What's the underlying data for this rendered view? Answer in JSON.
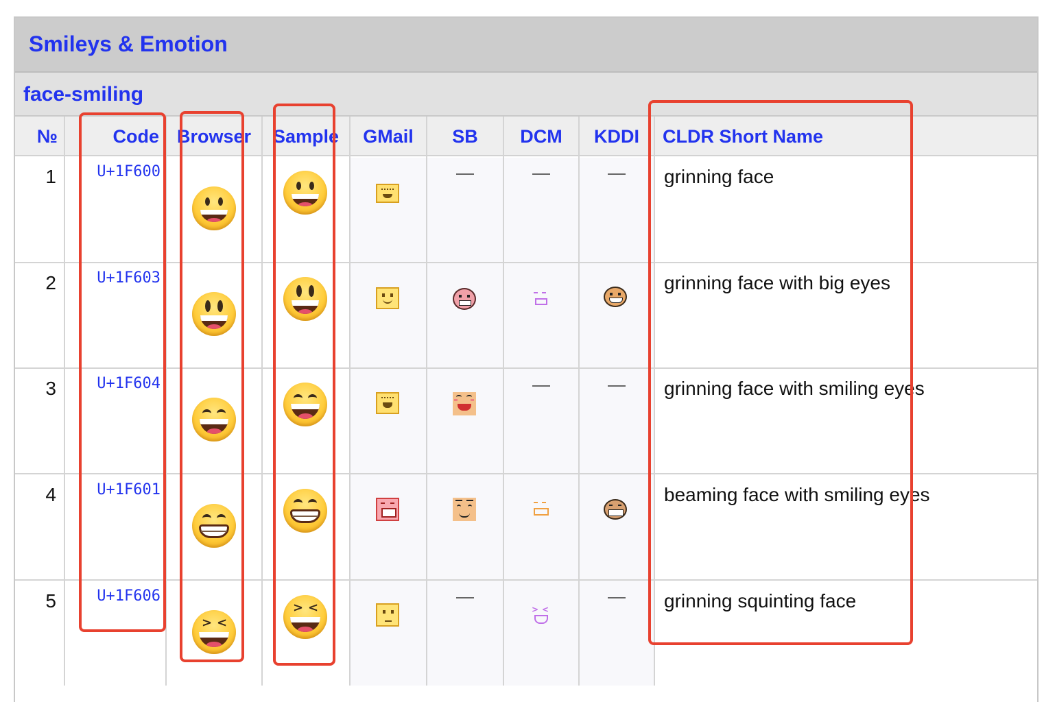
{
  "section": {
    "group": "Smileys & Emotion",
    "subgroup": "face-smiling"
  },
  "columns": [
    "№",
    "Code",
    "Browser",
    "Sample",
    "GMail",
    "SB",
    "DCM",
    "KDDI",
    "CLDR Short Name"
  ],
  "rows": [
    {
      "num": "1",
      "code": "U+1F600",
      "name": "grinning face"
    },
    {
      "num": "2",
      "code": "U+1F603",
      "name": "grinning face with big eyes"
    },
    {
      "num": "3",
      "code": "U+1F604",
      "name": "grinning face with smiling eyes"
    },
    {
      "num": "4",
      "code": "U+1F601",
      "name": "beaming face with smiling eyes"
    },
    {
      "num": "5",
      "code": "U+1F606",
      "name": "grinning squinting face"
    }
  ],
  "colors": {
    "link": "#2233ee",
    "header_bg": "#cccccc",
    "subheader_bg": "#e1e1e1",
    "column_header_bg": "#eeeeee",
    "annotation": "#e8412f"
  }
}
